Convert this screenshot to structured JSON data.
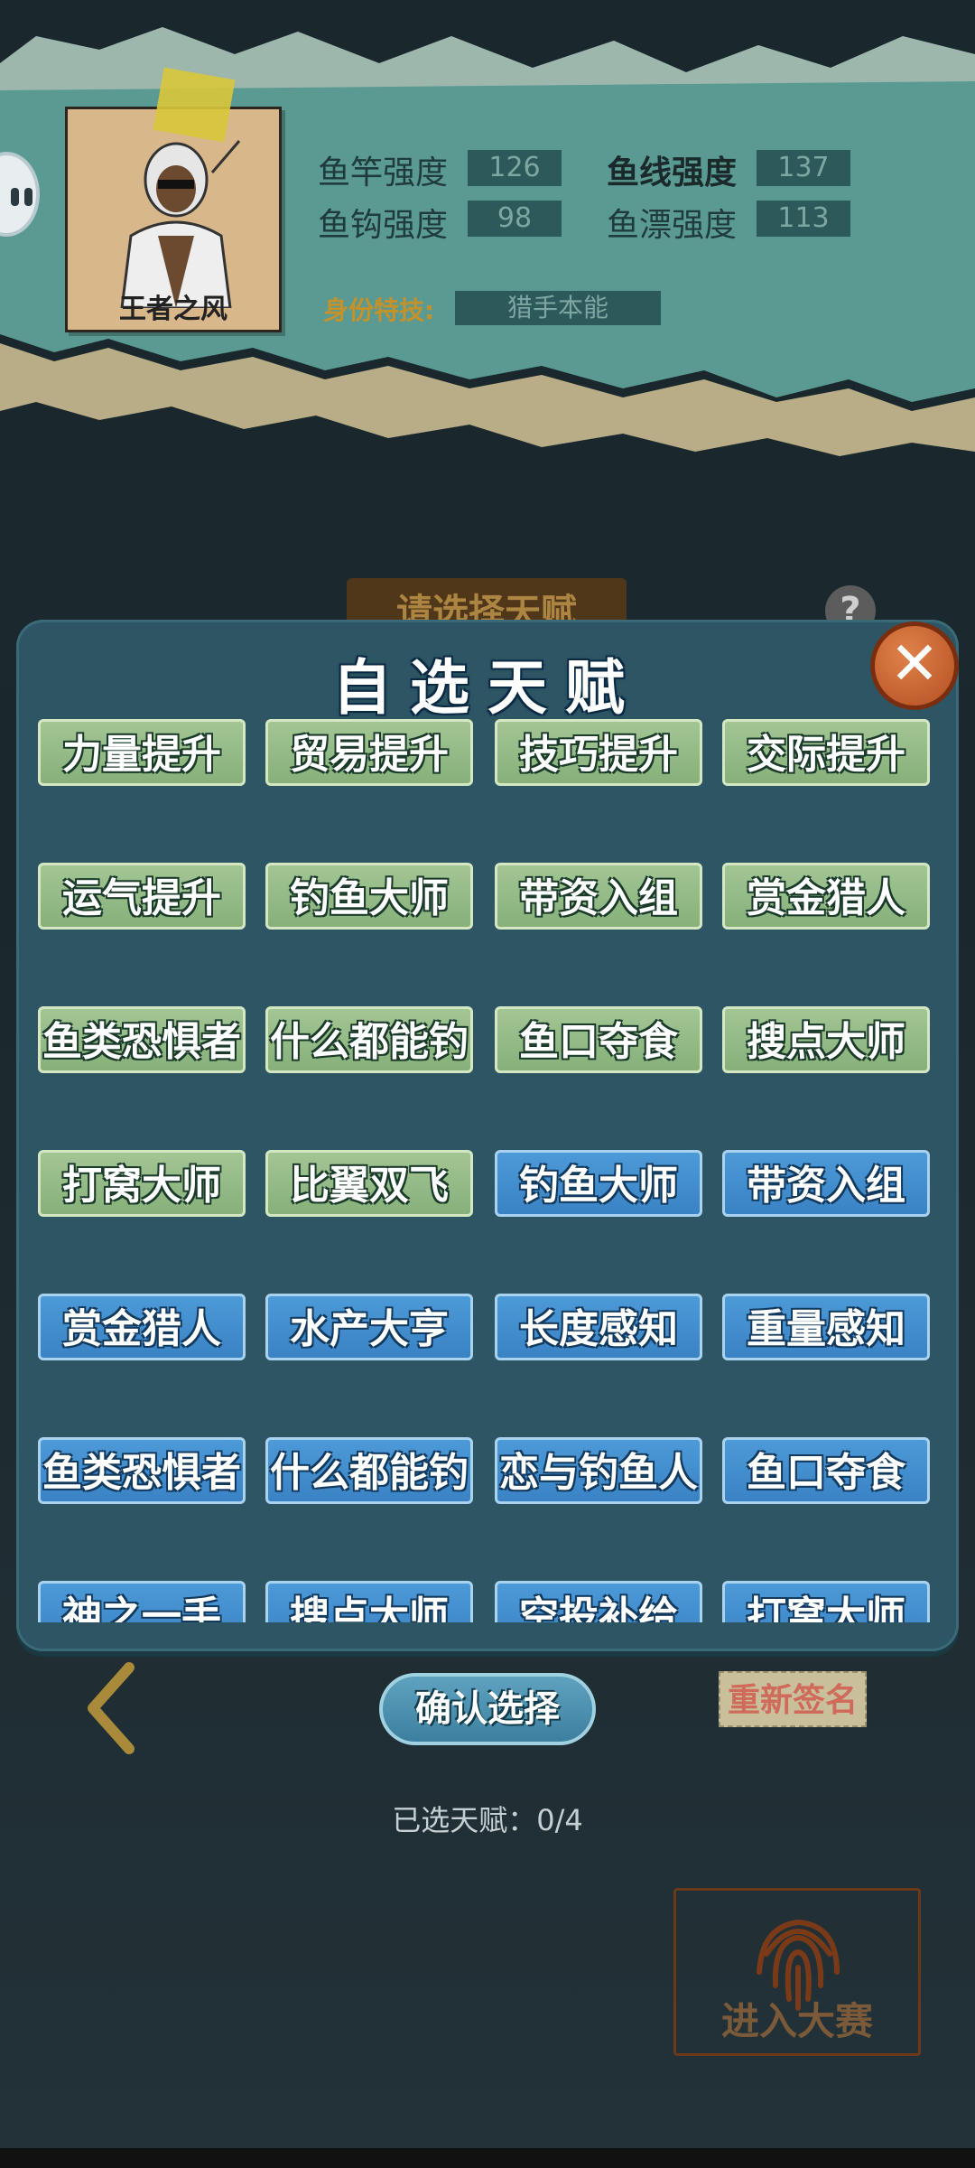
{
  "profile": {
    "player_name": "王者之风",
    "stats": [
      {
        "label": "鱼竿强度",
        "value": "126"
      },
      {
        "label": "鱼线强度",
        "value": "137"
      },
      {
        "label": "鱼钩强度",
        "value": "98"
      },
      {
        "label": "鱼漂强度",
        "value": "113"
      }
    ],
    "skill_label": "身份特技:",
    "skill_value": "猎手本能"
  },
  "background": {
    "title": "请选择天赋",
    "help_symbol": "?"
  },
  "modal": {
    "title": "自选天赋",
    "close_symbol": "✕",
    "talents": [
      {
        "label": "力量提升",
        "color": "green"
      },
      {
        "label": "贸易提升",
        "color": "green"
      },
      {
        "label": "技巧提升",
        "color": "green"
      },
      {
        "label": "交际提升",
        "color": "green"
      },
      {
        "label": "运气提升",
        "color": "green"
      },
      {
        "label": "钓鱼大师",
        "color": "green"
      },
      {
        "label": "带资入组",
        "color": "green"
      },
      {
        "label": "赏金猎人",
        "color": "green"
      },
      {
        "label": "鱼类恐惧者",
        "color": "green"
      },
      {
        "label": "什么都能钓",
        "color": "green"
      },
      {
        "label": "鱼口夺食",
        "color": "green"
      },
      {
        "label": "搜点大师",
        "color": "green"
      },
      {
        "label": "打窝大师",
        "color": "green"
      },
      {
        "label": "比翼双飞",
        "color": "green"
      },
      {
        "label": "钓鱼大师",
        "color": "blue"
      },
      {
        "label": "带资入组",
        "color": "blue"
      },
      {
        "label": "赏金猎人",
        "color": "blue"
      },
      {
        "label": "水产大亨",
        "color": "blue"
      },
      {
        "label": "长度感知",
        "color": "blue"
      },
      {
        "label": "重量感知",
        "color": "blue"
      },
      {
        "label": "鱼类恐惧者",
        "color": "blue"
      },
      {
        "label": "什么都能钓",
        "color": "blue"
      },
      {
        "label": "恋与钓鱼人",
        "color": "blue"
      },
      {
        "label": "鱼口夺食",
        "color": "blue"
      },
      {
        "label": "神之一手",
        "color": "blue"
      },
      {
        "label": "搜点大师",
        "color": "blue"
      },
      {
        "label": "空投补给",
        "color": "blue"
      },
      {
        "label": "打窝大师",
        "color": "blue"
      }
    ]
  },
  "actions": {
    "confirm_label": "确认选择",
    "resign_label": "重新签名",
    "selected_count": "已选天赋：0/4",
    "enter_label": "进入大赛"
  },
  "colors": {
    "modal_bg": "#2d5563",
    "talent_green": "#87b07a",
    "talent_blue": "#3a82c4",
    "close_orange": "#c8622e"
  }
}
